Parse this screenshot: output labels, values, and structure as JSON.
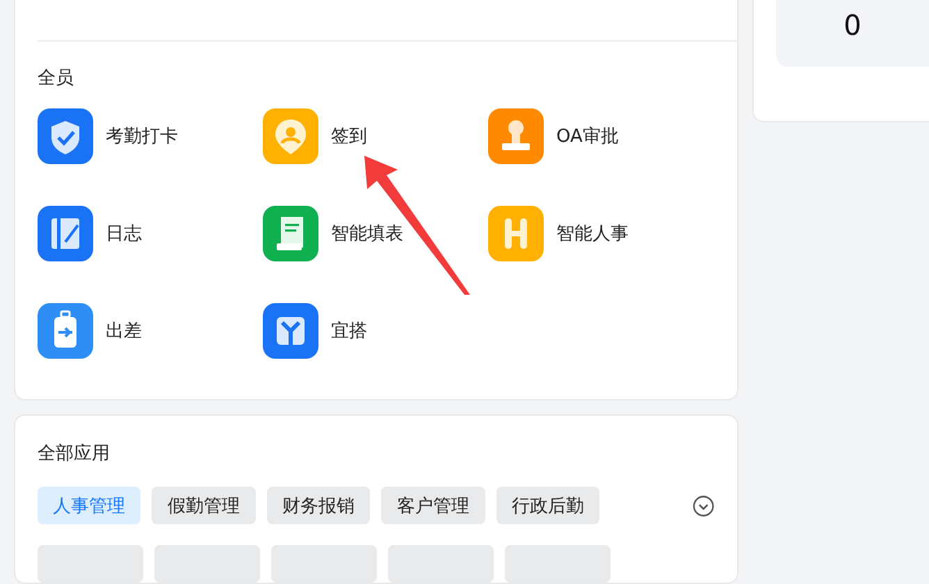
{
  "all_staff": {
    "title": "全员",
    "apps": [
      {
        "label": "考勤打卡",
        "kind": "shield",
        "color": "#1a73f5"
      },
      {
        "label": "签到",
        "kind": "pin",
        "color": "#ffb000"
      },
      {
        "label": "OA审批",
        "kind": "stamp",
        "color": "#ff8a00"
      },
      {
        "label": "日志",
        "kind": "notebook",
        "color": "#1a73f5"
      },
      {
        "label": "智能填表",
        "kind": "scroll",
        "color": "#10b050"
      },
      {
        "label": "智能人事",
        "kind": "letter",
        "color": "#ffb000"
      },
      {
        "label": "出差",
        "kind": "luggage",
        "color": "#2f8ef5"
      },
      {
        "label": "宜搭",
        "kind": "fork",
        "color": "#1a73f5"
      }
    ]
  },
  "stats": {
    "value": "0"
  },
  "all_apps": {
    "title": "全部应用",
    "tags": [
      {
        "label": "人事管理",
        "selected": true
      },
      {
        "label": "假勤管理",
        "selected": false
      },
      {
        "label": "财务报销",
        "selected": false
      },
      {
        "label": "客户管理",
        "selected": false
      },
      {
        "label": "行政后勤",
        "selected": false
      }
    ]
  }
}
